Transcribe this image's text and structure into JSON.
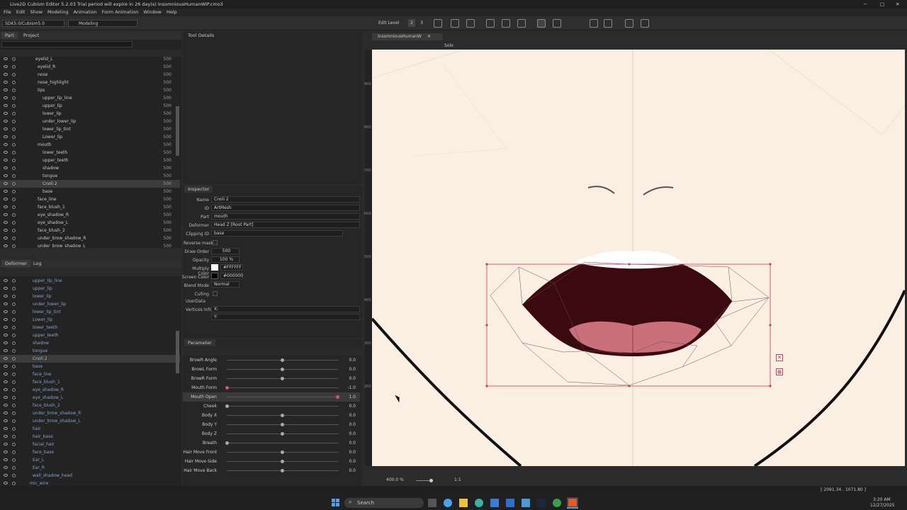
{
  "window": {
    "title": "Live2D Cubism Editor 5.2.03    Trial period will expire in 26 day(s)    InsomniousHumanWIP.cmo3"
  },
  "menu": [
    "File",
    "Edit",
    "Show",
    "Modeling",
    "Animation",
    "Form Animation",
    "Window",
    "Help"
  ],
  "toolbar": {
    "sdk": "SDK5.0/Cubism5.0",
    "mode": "Modeling",
    "edit_level": "Edit Level",
    "level1": "2",
    "level2": "3"
  },
  "panels": {
    "part_tab": "Part",
    "project_tab": "Project",
    "tool_details": "Tool Details",
    "inspector": "Inspector",
    "deformer_tab": "Deformer",
    "log_tab": "Log",
    "parameter": "Parameter"
  },
  "parts": [
    {
      "name": "eyelid_L",
      "val": "500",
      "indent": 50
    },
    {
      "name": "eyelid_R",
      "val": "500",
      "indent": 53
    },
    {
      "name": "nose",
      "val": "500",
      "indent": 53
    },
    {
      "name": "nose_highlight",
      "val": "500",
      "indent": 53
    },
    {
      "name": "lips",
      "val": "500",
      "indent": 53
    },
    {
      "name": "upper_lip_line",
      "val": "500",
      "indent": 60
    },
    {
      "name": "upper_lip",
      "val": "500",
      "indent": 60
    },
    {
      "name": "lower_lip",
      "val": "500",
      "indent": 60
    },
    {
      "name": "under_lower_lip",
      "val": "500",
      "indent": 60
    },
    {
      "name": "lower_lip_tint",
      "val": "500",
      "indent": 60
    },
    {
      "name": "Lower_lip",
      "val": "500",
      "indent": 60
    },
    {
      "name": "mouth",
      "val": "500",
      "indent": 53
    },
    {
      "name": "lower_teeth",
      "val": "500",
      "indent": 60
    },
    {
      "name": "upper_teeth",
      "val": "500",
      "indent": 60
    },
    {
      "name": "shadow",
      "val": "500",
      "indent": 60
    },
    {
      "name": "tongue",
      "val": "500",
      "indent": 60
    },
    {
      "name": "Cnoli 2",
      "val": "500",
      "indent": 60,
      "sel": true
    },
    {
      "name": "base",
      "val": "500",
      "indent": 60
    },
    {
      "name": "face_line",
      "val": "500",
      "indent": 53
    },
    {
      "name": "face_blush_1",
      "val": "500",
      "indent": 53
    },
    {
      "name": "eye_shadow_R",
      "val": "500",
      "indent": 53
    },
    {
      "name": "eye_shadow_L",
      "val": "500",
      "indent": 53
    },
    {
      "name": "face_blush_2",
      "val": "500",
      "indent": 53
    },
    {
      "name": "under_brow_shadow_R",
      "val": "500",
      "indent": 53
    },
    {
      "name": "under_brow_shadow_L",
      "val": "500",
      "indent": 53
    }
  ],
  "deformers": [
    {
      "name": "upper_lip_line",
      "indent": 46
    },
    {
      "name": "upper_lip",
      "indent": 46
    },
    {
      "name": "lower_lip",
      "indent": 46
    },
    {
      "name": "under_lower_lip",
      "indent": 46
    },
    {
      "name": "lower_lip_tint",
      "indent": 46
    },
    {
      "name": "Lower_lip",
      "indent": 46
    },
    {
      "name": "lower_teeth",
      "indent": 46
    },
    {
      "name": "upper_teeth",
      "indent": 46
    },
    {
      "name": "shadow",
      "indent": 46
    },
    {
      "name": "tongue",
      "indent": 46
    },
    {
      "name": "Cnoli 2",
      "indent": 46,
      "sel": true
    },
    {
      "name": "base",
      "indent": 46
    },
    {
      "name": "face_line",
      "indent": 46
    },
    {
      "name": "face_blush_1",
      "indent": 46
    },
    {
      "name": "eye_shadow_R",
      "indent": 46
    },
    {
      "name": "eye_shadow_L",
      "indent": 46
    },
    {
      "name": "face_blush_2",
      "indent": 46
    },
    {
      "name": "under_brow_shadow_R",
      "indent": 46
    },
    {
      "name": "under_brow_shadow_L",
      "indent": 46
    },
    {
      "name": "hair",
      "indent": 46
    },
    {
      "name": "hair_base",
      "indent": 46
    },
    {
      "name": "facial_hair",
      "indent": 46
    },
    {
      "name": "face_base",
      "indent": 46
    },
    {
      "name": "Ear_L",
      "indent": 46
    },
    {
      "name": "Ear_R",
      "indent": 46
    },
    {
      "name": "wall_shadow_head",
      "indent": 46
    },
    {
      "name": "mic_wire",
      "indent": 42
    }
  ],
  "inspector": {
    "name_label": "Name",
    "name": "Cnoli 2",
    "id_label": "ID",
    "id": "ArtMesh",
    "part_label": "Part",
    "part": "mouth",
    "deformer_label": "Deformer",
    "deformer": "Head Z  [Root Part]",
    "clip_label": "Clipping ID",
    "clip": "base",
    "reverse_label": "Reverse mask",
    "draw_label": "Draw Order",
    "draw": "500",
    "opacity_label": "Opacity",
    "opacity": "100 %",
    "mult_label": "Multiply Color",
    "mult": "#FFFFFF",
    "screen_label": "Screen Color",
    "screen": "#000000",
    "blend_label": "Blend Mode",
    "blend": "Normal",
    "culling_label": "Culling",
    "userdata_label": "UserData",
    "vert_label": "Vertices Info",
    "vx": "X:",
    "vy": "Y:"
  },
  "parameters": [
    {
      "name": "BrowR Angle",
      "value": "0.0",
      "knob": 0.5
    },
    {
      "name": "BrowL Form",
      "value": "0.0",
      "knob": 0.5
    },
    {
      "name": "BrowR Form",
      "value": "0.0",
      "knob": 0.5
    },
    {
      "name": "Mouth Form",
      "value": "-1.0",
      "knob": 0.0,
      "accent": true
    },
    {
      "name": "Mouth Open",
      "value": "1.0",
      "knob": 1.0,
      "accent": true,
      "hl": true
    },
    {
      "name": "Cheek",
      "value": "0.0",
      "knob": 0.0
    },
    {
      "name": "Body X",
      "value": "0.0",
      "knob": 0.5
    },
    {
      "name": "Body Y",
      "value": "0.0",
      "knob": 0.5
    },
    {
      "name": "Body Z",
      "value": "0.0",
      "knob": 0.5
    },
    {
      "name": "Breath",
      "value": "0.0",
      "knob": 0.0
    },
    {
      "name": "Hair Move Front",
      "value": "0.0",
      "knob": 0.5
    },
    {
      "name": "Hair Move Side",
      "value": "0.0",
      "knob": 0.5
    },
    {
      "name": "Hair Move Back",
      "value": "0.0",
      "knob": 0.5
    }
  ],
  "viewport": {
    "tab": "InsomniousHumanW",
    "solo": "Solo",
    "zoom": "400.0 %",
    "ratio": "1:1",
    "ticks": [
      "900",
      "800",
      "700",
      "600",
      "500",
      "400",
      "300",
      "200"
    ]
  },
  "status": {
    "coords": "[ 2091.34 , 1071.80 ]"
  },
  "taskbar": {
    "search": "Search",
    "time": "3:20 AM",
    "date": "12/27/2025"
  },
  "colors": {
    "accent": "#e0506a",
    "mouth_dark": "#3a0a10",
    "tongue": "#c9707a",
    "skin": "#fbeee2"
  }
}
